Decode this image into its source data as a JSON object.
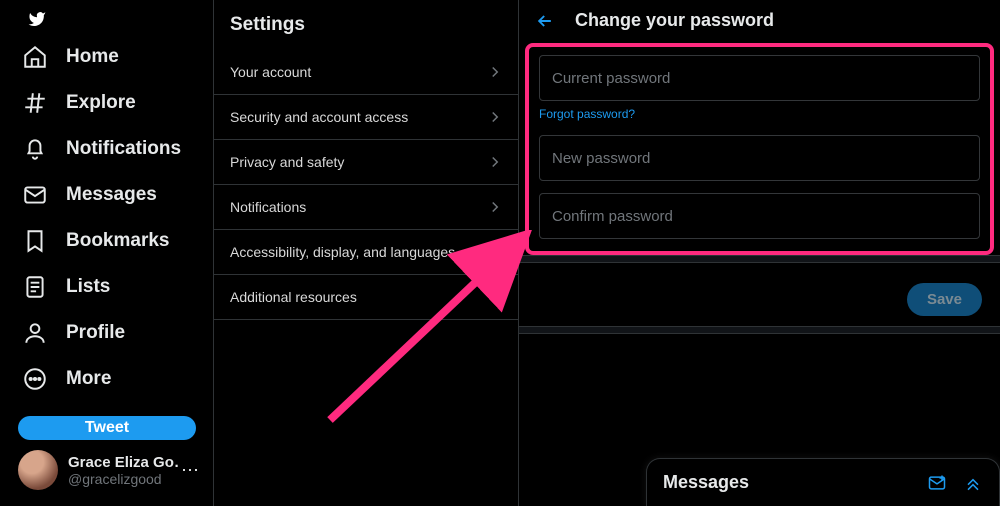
{
  "nav": {
    "items": [
      {
        "label": "Home"
      },
      {
        "label": "Explore"
      },
      {
        "label": "Notifications"
      },
      {
        "label": "Messages"
      },
      {
        "label": "Bookmarks"
      },
      {
        "label": "Lists"
      },
      {
        "label": "Profile"
      },
      {
        "label": "More"
      }
    ],
    "tweet_button": "Tweet"
  },
  "account": {
    "display_name": "Grace Eliza Go…",
    "handle": "@gracelizgood",
    "verified": true
  },
  "settings": {
    "heading": "Settings",
    "items": [
      {
        "label": "Your account"
      },
      {
        "label": "Security and account access"
      },
      {
        "label": "Privacy and safety"
      },
      {
        "label": "Notifications"
      },
      {
        "label": "Accessibility, display, and languages"
      },
      {
        "label": "Additional resources"
      }
    ]
  },
  "content": {
    "title": "Change your password",
    "current_password_placeholder": "Current password",
    "current_password_value": "",
    "forgot_link": "Forgot password?",
    "new_password_placeholder": "New password",
    "new_password_value": "",
    "confirm_password_placeholder": "Confirm password",
    "confirm_password_value": "",
    "save_button": "Save"
  },
  "drawer": {
    "title": "Messages"
  },
  "colors": {
    "accent": "#1d9bf0",
    "highlight": "#ff2a7f"
  }
}
